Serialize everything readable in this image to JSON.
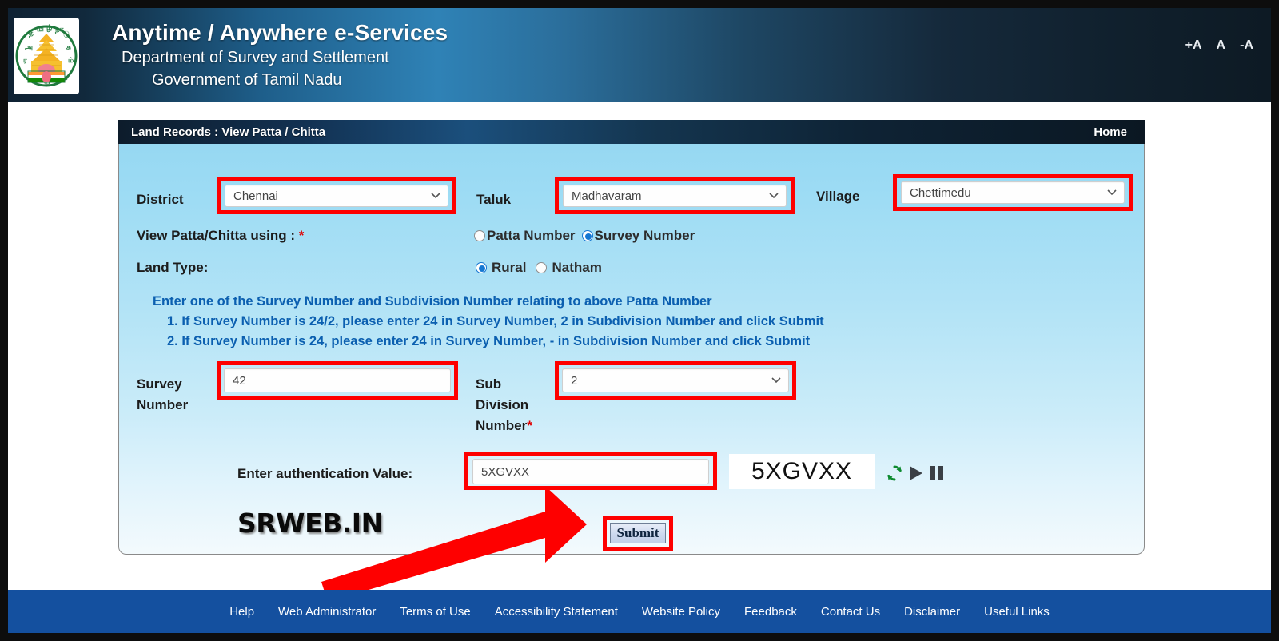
{
  "header": {
    "title": "Anytime / Anywhere e-Services",
    "subtitle1": "Department of Survey and Settlement",
    "subtitle2": "Government of Tamil Nadu",
    "emblem_alt": "tamil-nadu-emblem",
    "font_increase": "+A",
    "font_normal": "A",
    "font_decrease": "-A"
  },
  "card": {
    "title": "Land Records : View Patta / Chitta",
    "home_link": "Home"
  },
  "form": {
    "district_label": "District",
    "district_value": "Chennai",
    "taluk_label": "Taluk",
    "taluk_value": "Madhavaram",
    "village_label": "Village",
    "village_value": "Chettimedu",
    "view_using_label": "View Patta/Chitta using :",
    "view_using_required": "*",
    "option_patta": "Patta Number",
    "option_survey": "Survey Number",
    "land_type_label": "Land Type:",
    "option_rural": "Rural",
    "option_natham": "Natham",
    "note_line1": "Enter one of the Survey Number and Subdivision Number relating to above Patta Number",
    "note_line2": "1. If Survey Number is 24/2, please enter 24 in Survey Number, 2 in Subdivision Number and click Submit",
    "note_line3": "2. If Survey Number is 24, please enter 24 in Survey Number, - in Subdivision Number and click Submit",
    "survey_label_line1": "Survey",
    "survey_label_line2": "Number",
    "survey_value": "42",
    "subdiv_label_line1": "Sub",
    "subdiv_label_line2": "Division",
    "subdiv_label_line3": "Number",
    "subdiv_required": "*",
    "subdiv_value": "2",
    "auth_label": "Enter authentication Value:",
    "auth_value": "5XGVXX",
    "captcha_text": "5XGVXX",
    "refresh_icon": "refresh-icon",
    "play_icon": "play-icon",
    "pause_icon": "pause-icon",
    "submit_label": "Submit"
  },
  "watermark": {
    "text": "SRWEB.IN"
  },
  "footer": {
    "links": [
      "Help",
      "Web Administrator",
      "Terms of Use",
      "Accessibility Statement",
      "Website Policy",
      "Feedback",
      "Contact Us",
      "Disclaimer",
      "Useful Links"
    ]
  },
  "colors": {
    "highlight": "#fe0000",
    "footer_blue": "#14509f",
    "note_blue": "#0b5fb0",
    "radio_accent": "#1577d2"
  }
}
